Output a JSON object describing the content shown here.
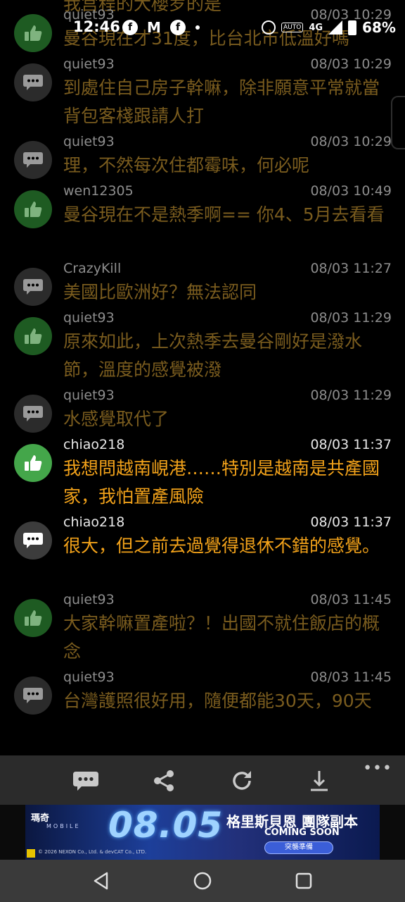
{
  "status_bar": {
    "time": "12:46",
    "network": "4G",
    "battery": "68%"
  },
  "cut_off_text": "我宫程的大櫻罗的是",
  "messages": [
    {
      "user": "quiet93",
      "time": "08/03 10:29",
      "text": "曼谷現在才31度，比台北市低溫好嗎",
      "icon": "thumbs-up-icon",
      "active": false
    },
    {
      "user": "quiet93",
      "time": "08/03 10:29",
      "text": "到處住自己房子幹嘛，除非願意平常就當背包客棧跟請人打",
      "icon": "chat-bubble-icon",
      "active": false
    },
    {
      "user": "quiet93",
      "time": "08/03 10:29",
      "text": "理，不然每次住都霉味，何必呢",
      "icon": "chat-bubble-icon",
      "active": false
    },
    {
      "user": "wen12305",
      "time": "08/03 10:49",
      "text": "曼谷現在不是熱季啊== 你4、5月去看看",
      "icon": "thumbs-up-icon",
      "active": false
    },
    {
      "user": "CrazyKill",
      "time": "08/03 11:27",
      "text": "美國比歐洲好？無法認同",
      "icon": "chat-bubble-icon",
      "active": false
    },
    {
      "user": "quiet93",
      "time": "08/03 11:29",
      "text": "原來如此，上次熱季去曼谷剛好是潑水節，溫度的感覺被潑",
      "icon": "thumbs-up-icon",
      "active": false
    },
    {
      "user": "quiet93",
      "time": "08/03 11:29",
      "text": "水感覺取代了",
      "icon": "chat-bubble-icon",
      "active": false
    },
    {
      "user": "chiao218",
      "time": "08/03 11:37",
      "text": "我想問越南峴港……特別是越南是共產國家，我怕置產風險",
      "icon": "thumbs-up-icon",
      "active": true
    },
    {
      "user": "chiao218",
      "time": "08/03 11:37",
      "text": "很大，但之前去過覺得退休不錯的感覺。",
      "icon": "chat-bubble-icon",
      "active": true
    },
    {
      "user": "quiet93",
      "time": "08/03 11:45",
      "text": "大家幹嘛置產啦？！出國不就住飯店的概念",
      "icon": "thumbs-up-icon",
      "active": false
    },
    {
      "user": "quiet93",
      "time": "08/03 11:45",
      "text": "台灣護照很好用，隨便都能30天，90天",
      "icon": "chat-bubble-icon",
      "active": false
    }
  ],
  "toolbar": {
    "more": "•••",
    "buttons": [
      "comment-icon",
      "share-icon",
      "refresh-icon",
      "download-icon"
    ]
  },
  "ad": {
    "brand": "瑪奇",
    "brand_sub": "MOBILE",
    "date": "08.05",
    "title": "格里斯貝恩 團隊副本",
    "coming": "COMING SOON",
    "cta": "突襲準備",
    "copyright": "© 2026 NEXON Co., Ltd. & devCAT Co., LTD."
  },
  "colors": {
    "active_text": "#f2a21a",
    "dim_text": "#7a5c1e",
    "like_active": "#44a64a",
    "like_dim": "#1e5b22"
  }
}
